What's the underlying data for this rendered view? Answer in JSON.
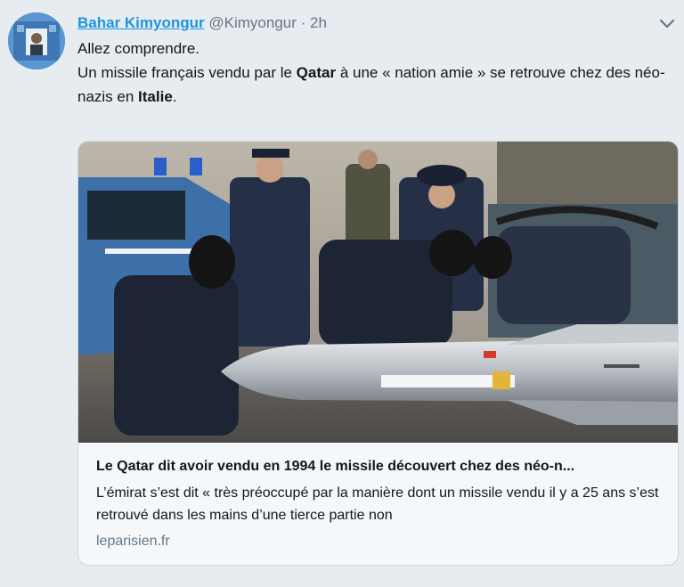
{
  "tweet": {
    "author_name": "Bahar Kimyongur",
    "author_handle": "@Kimyongur",
    "separator": "·",
    "time": "2h",
    "line1": "Allez comprendre.",
    "line2_a": "Un missile français vendu par le ",
    "line2_bold1": "Qatar",
    "line2_b": " à une « nation amie » se retrouve chez des néo-nazis en ",
    "line2_bold2": "Italie",
    "line2_c": "."
  },
  "card": {
    "title": "Le Qatar dit avoir vendu en 1994 le missile découvert chez des néo-n...",
    "description": "L’émirat s’est dit « très préoccupé par la manière dont un missile vendu il y a 25 ans s’est retrouvé dans les mains d’une tierce partie non",
    "domain": "leparisien.fr",
    "image_icon": "news-photo-police-missile"
  },
  "icons": {
    "menu": "chevron-down-icon",
    "avatar": "avatar"
  },
  "colors": {
    "background": "#e6ecf0",
    "link": "#1b95e0",
    "muted": "#657786",
    "text": "#14171a"
  }
}
